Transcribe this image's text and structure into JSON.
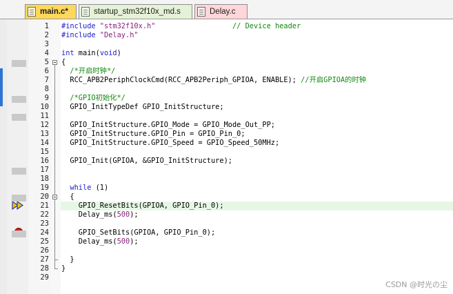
{
  "tabs": [
    {
      "label": "main.c*",
      "active": true
    },
    {
      "label": "startup_stm32f10x_md.s",
      "active": false
    },
    {
      "label": "Delay.c",
      "active": false
    }
  ],
  "editor": {
    "current_line": 21,
    "breakpoint_line": 24,
    "lines": [
      {
        "n": "1",
        "segs": [
          {
            "t": "#include ",
            "c": "pre"
          },
          {
            "t": "\"stm32f10x.h\"",
            "c": "str"
          },
          {
            "t": "                  ",
            "c": ""
          },
          {
            "t": "// Device header",
            "c": "cmt"
          }
        ]
      },
      {
        "n": "2",
        "segs": [
          {
            "t": "#include ",
            "c": "pre"
          },
          {
            "t": "\"Delay.h\"",
            "c": "str"
          }
        ]
      },
      {
        "n": "3",
        "segs": []
      },
      {
        "n": "4",
        "segs": [
          {
            "t": "int",
            "c": "kw"
          },
          {
            "t": " main(",
            "c": ""
          },
          {
            "t": "void",
            "c": "kw"
          },
          {
            "t": ")",
            "c": ""
          }
        ]
      },
      {
        "n": "5",
        "segs": [
          {
            "t": "{",
            "c": ""
          }
        ]
      },
      {
        "n": "6",
        "segs": [
          {
            "t": "  /*开启时钟*/",
            "c": "cmt"
          }
        ]
      },
      {
        "n": "7",
        "segs": [
          {
            "t": "  RCC_APB2PeriphClockCmd(RCC_APB2Periph_GPIOA, ENABLE); ",
            "c": ""
          },
          {
            "t": "//开启GPIOA的时钟",
            "c": "cmt"
          }
        ]
      },
      {
        "n": "8",
        "segs": []
      },
      {
        "n": "9",
        "segs": [
          {
            "t": "  /*GPIO初始化*/",
            "c": "cmt"
          }
        ]
      },
      {
        "n": "10",
        "segs": [
          {
            "t": "  GPIO_InitTypeDef GPIO_InitStructure;",
            "c": ""
          }
        ]
      },
      {
        "n": "11",
        "segs": []
      },
      {
        "n": "12",
        "segs": [
          {
            "t": "  GPIO_InitStructure.GPIO_Mode = GPIO_Mode_Out_PP;",
            "c": ""
          }
        ]
      },
      {
        "n": "13",
        "segs": [
          {
            "t": "  GPIO_InitStructure.GPIO_Pin = GPIO_Pin_0;",
            "c": ""
          }
        ]
      },
      {
        "n": "14",
        "segs": [
          {
            "t": "  GPIO_InitStructure.GPIO_Speed = GPIO_Speed_50MHz;",
            "c": ""
          }
        ]
      },
      {
        "n": "15",
        "segs": []
      },
      {
        "n": "16",
        "segs": [
          {
            "t": "  GPIO_Init(GPIOA, &GPIO_InitStructure);",
            "c": ""
          }
        ]
      },
      {
        "n": "17",
        "segs": []
      },
      {
        "n": "18",
        "segs": []
      },
      {
        "n": "19",
        "segs": [
          {
            "t": "  ",
            "c": ""
          },
          {
            "t": "while",
            "c": "kw"
          },
          {
            "t": " (1)",
            "c": ""
          }
        ]
      },
      {
        "n": "20",
        "segs": [
          {
            "t": "  {",
            "c": ""
          }
        ]
      },
      {
        "n": "21",
        "segs": [
          {
            "t": "    GPIO_ResetBits(GPIOA, GPIO_Pin_0);",
            "c": ""
          }
        ]
      },
      {
        "n": "22",
        "segs": [
          {
            "t": "    Delay_ms(",
            "c": ""
          },
          {
            "t": "500",
            "c": "num"
          },
          {
            "t": ");",
            "c": ""
          }
        ]
      },
      {
        "n": "23",
        "segs": []
      },
      {
        "n": "24",
        "segs": [
          {
            "t": "    GPIO_SetBits(GPIOA, GPIO_Pin_0);",
            "c": ""
          }
        ]
      },
      {
        "n": "25",
        "segs": [
          {
            "t": "    Delay_ms(",
            "c": ""
          },
          {
            "t": "500",
            "c": "num"
          },
          {
            "t": ");",
            "c": ""
          }
        ]
      },
      {
        "n": "26",
        "segs": []
      },
      {
        "n": "27",
        "segs": [
          {
            "t": "  }",
            "c": ""
          }
        ]
      },
      {
        "n": "28",
        "segs": [
          {
            "t": "}",
            "c": ""
          }
        ]
      },
      {
        "n": "29",
        "segs": []
      }
    ]
  },
  "watermark": "CSDN @时光の尘"
}
